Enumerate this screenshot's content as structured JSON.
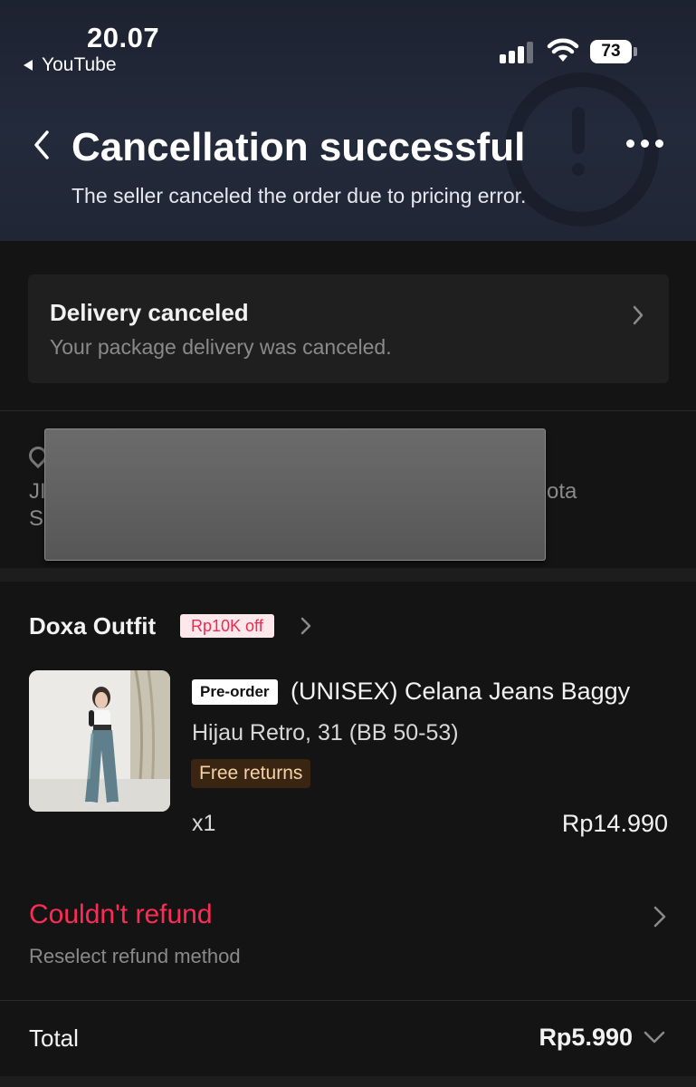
{
  "status_bar": {
    "time": "20.07",
    "back_app": "YouTube",
    "battery": "73"
  },
  "header": {
    "title": "Cancellation successful",
    "subtitle": "The seller canceled the order due to pricing error."
  },
  "delivery": {
    "title": "Delivery canceled",
    "subtitle": "Your package delivery was canceled."
  },
  "address": {
    "line1_start": "JI",
    "line1_end": "ota",
    "line2_start": "S"
  },
  "shop": {
    "name": "Doxa Outfit",
    "discount": "Rp10K off"
  },
  "product": {
    "badge": "Pre-order",
    "title": "(UNISEX) Celana Jeans Baggy",
    "variant": "Hijau Retro, 31 (BB 50-53)",
    "tag": "Free returns",
    "quantity": "x1",
    "price": "Rp14.990"
  },
  "refund": {
    "title": "Couldn't refund",
    "subtitle": "Reselect refund method"
  },
  "total": {
    "label": "Total",
    "value": "Rp5.990"
  },
  "colors": {
    "accent_red": "#fe2c55",
    "background": "#141414",
    "card": "#1f1f1f"
  }
}
